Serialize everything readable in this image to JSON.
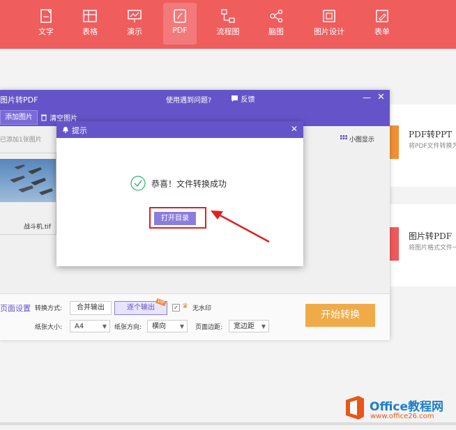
{
  "nav": {
    "items": [
      {
        "label": "文字"
      },
      {
        "label": "表格"
      },
      {
        "label": "演示"
      },
      {
        "label": "PDF"
      },
      {
        "label": "流程图"
      },
      {
        "label": "脑图"
      },
      {
        "label": "图片设计"
      },
      {
        "label": "表单"
      }
    ],
    "active": "PDF"
  },
  "cards": [
    {
      "title": "PDF转PPT",
      "desc": "将PDF文件转换为"
    },
    {
      "title": "图片转PDF",
      "desc": "将图片格式文件一"
    }
  ],
  "window": {
    "title": "图片转PDF",
    "help_link": "使用遇到问题?",
    "feedback": "反馈",
    "add_image": "添加图片",
    "clear_images": "清空图片",
    "count_text": "已添加1张图片",
    "view_mode": "小图显示",
    "thumb_caption": "战斗机.tif",
    "settings": {
      "section_title": "页面设置",
      "convert_mode_label": "转换方式:",
      "merge_output": "合并输出",
      "each_output": "逐个输出",
      "vip_badge": "VIP",
      "no_watermark": "无水印",
      "paper_size_label": "纸张大小:",
      "paper_size": "A4",
      "orientation_label": "纸张方向:",
      "orientation": "横向",
      "margin_label": "页面边距:",
      "margin": "宽边距"
    },
    "start_button": "开始转换"
  },
  "dialog": {
    "title": "提示",
    "message": "恭喜！文件转换成功",
    "open_dir": "打开目录"
  },
  "watermark": {
    "line1": "Office教程网",
    "line2": "www.office26.com"
  },
  "colors": {
    "nav_bg": "#ef5d5d",
    "purple": "#6554c9",
    "orange": "#f0ab49",
    "red_card": "#ee5a5a",
    "orange_card": "#f09035",
    "highlight": "#e02020"
  }
}
